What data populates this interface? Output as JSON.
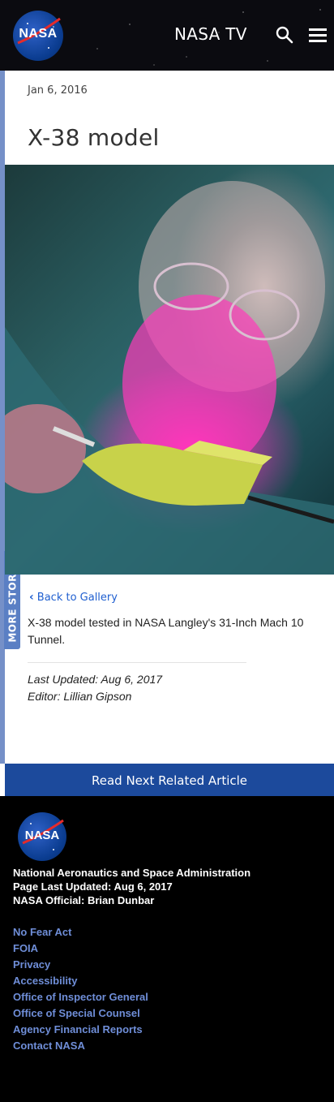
{
  "header": {
    "logo_text": "NASA",
    "nasa_tv": "NASA TV",
    "search_icon": "search-icon",
    "menu_icon": "hamburger-menu-icon"
  },
  "sidebar_tab": {
    "label": "MORE STORIES"
  },
  "article": {
    "date": "Jan 6, 2016",
    "title": "X-38 model",
    "back_label": "Back to Gallery",
    "caption": "X-38 model tested in NASA Langley's 31-Inch Mach 10 Tunnel.",
    "last_updated": "Last Updated: Aug 6, 2017",
    "editor": "Editor: Lillian Gipson"
  },
  "read_next": {
    "label": "Read Next Related Article"
  },
  "footer": {
    "logo_text": "NASA",
    "agency": "National Aeronautics and Space Administration",
    "page_updated": "Page Last Updated: Aug 6, 2017",
    "official": "NASA Official: Brian Dunbar",
    "links": [
      "No Fear Act",
      "FOIA",
      "Privacy",
      "Accessibility",
      "Office of Inspector General",
      "Office of Special Counsel",
      "Agency Financial Reports",
      "Contact NASA"
    ]
  },
  "colors": {
    "header_bg": "#0b0b10",
    "nasa_blue": "#0b3d91",
    "read_next_bg": "#1c4a9c",
    "link_blue": "#1f5fd0",
    "footer_link": "#6f8ed8",
    "sidebar_tab": "#5a7fc4"
  }
}
